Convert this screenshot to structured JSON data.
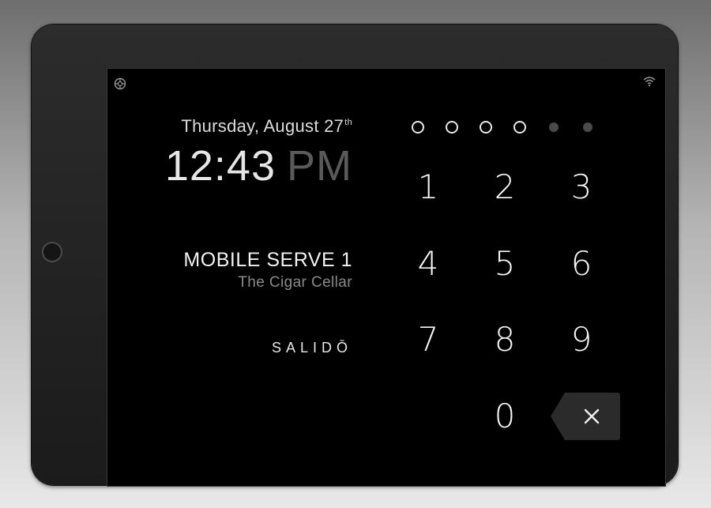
{
  "lock_screen": {
    "date": {
      "weekday_month": "Thursday, August 27",
      "day_suffix": "th"
    },
    "time": {
      "hour_minute": "12:43",
      "ampm": "PM"
    },
    "terminal_name": "MOBILE SERVE 1",
    "location_name": "The Cigar Cellar",
    "brand": "SALIDŌ"
  },
  "passcode": {
    "length": 6,
    "entered": 4
  },
  "keypad": {
    "keys": [
      "1",
      "2",
      "3",
      "4",
      "5",
      "6",
      "7",
      "8",
      "9",
      "0"
    ],
    "backspace_icon": "backspace-x-icon"
  },
  "status_bar": {
    "left_icon": "settings-target-icon",
    "right_icon": "wifi-icon"
  },
  "colors": {
    "background": "#000000",
    "primary_text": "#f2f2f2",
    "muted_text": "#8a8a8a",
    "ampm_text": "#5a5a5a",
    "dot_empty": "#4a4a4a",
    "backspace_bg": "#2b2b2b"
  }
}
